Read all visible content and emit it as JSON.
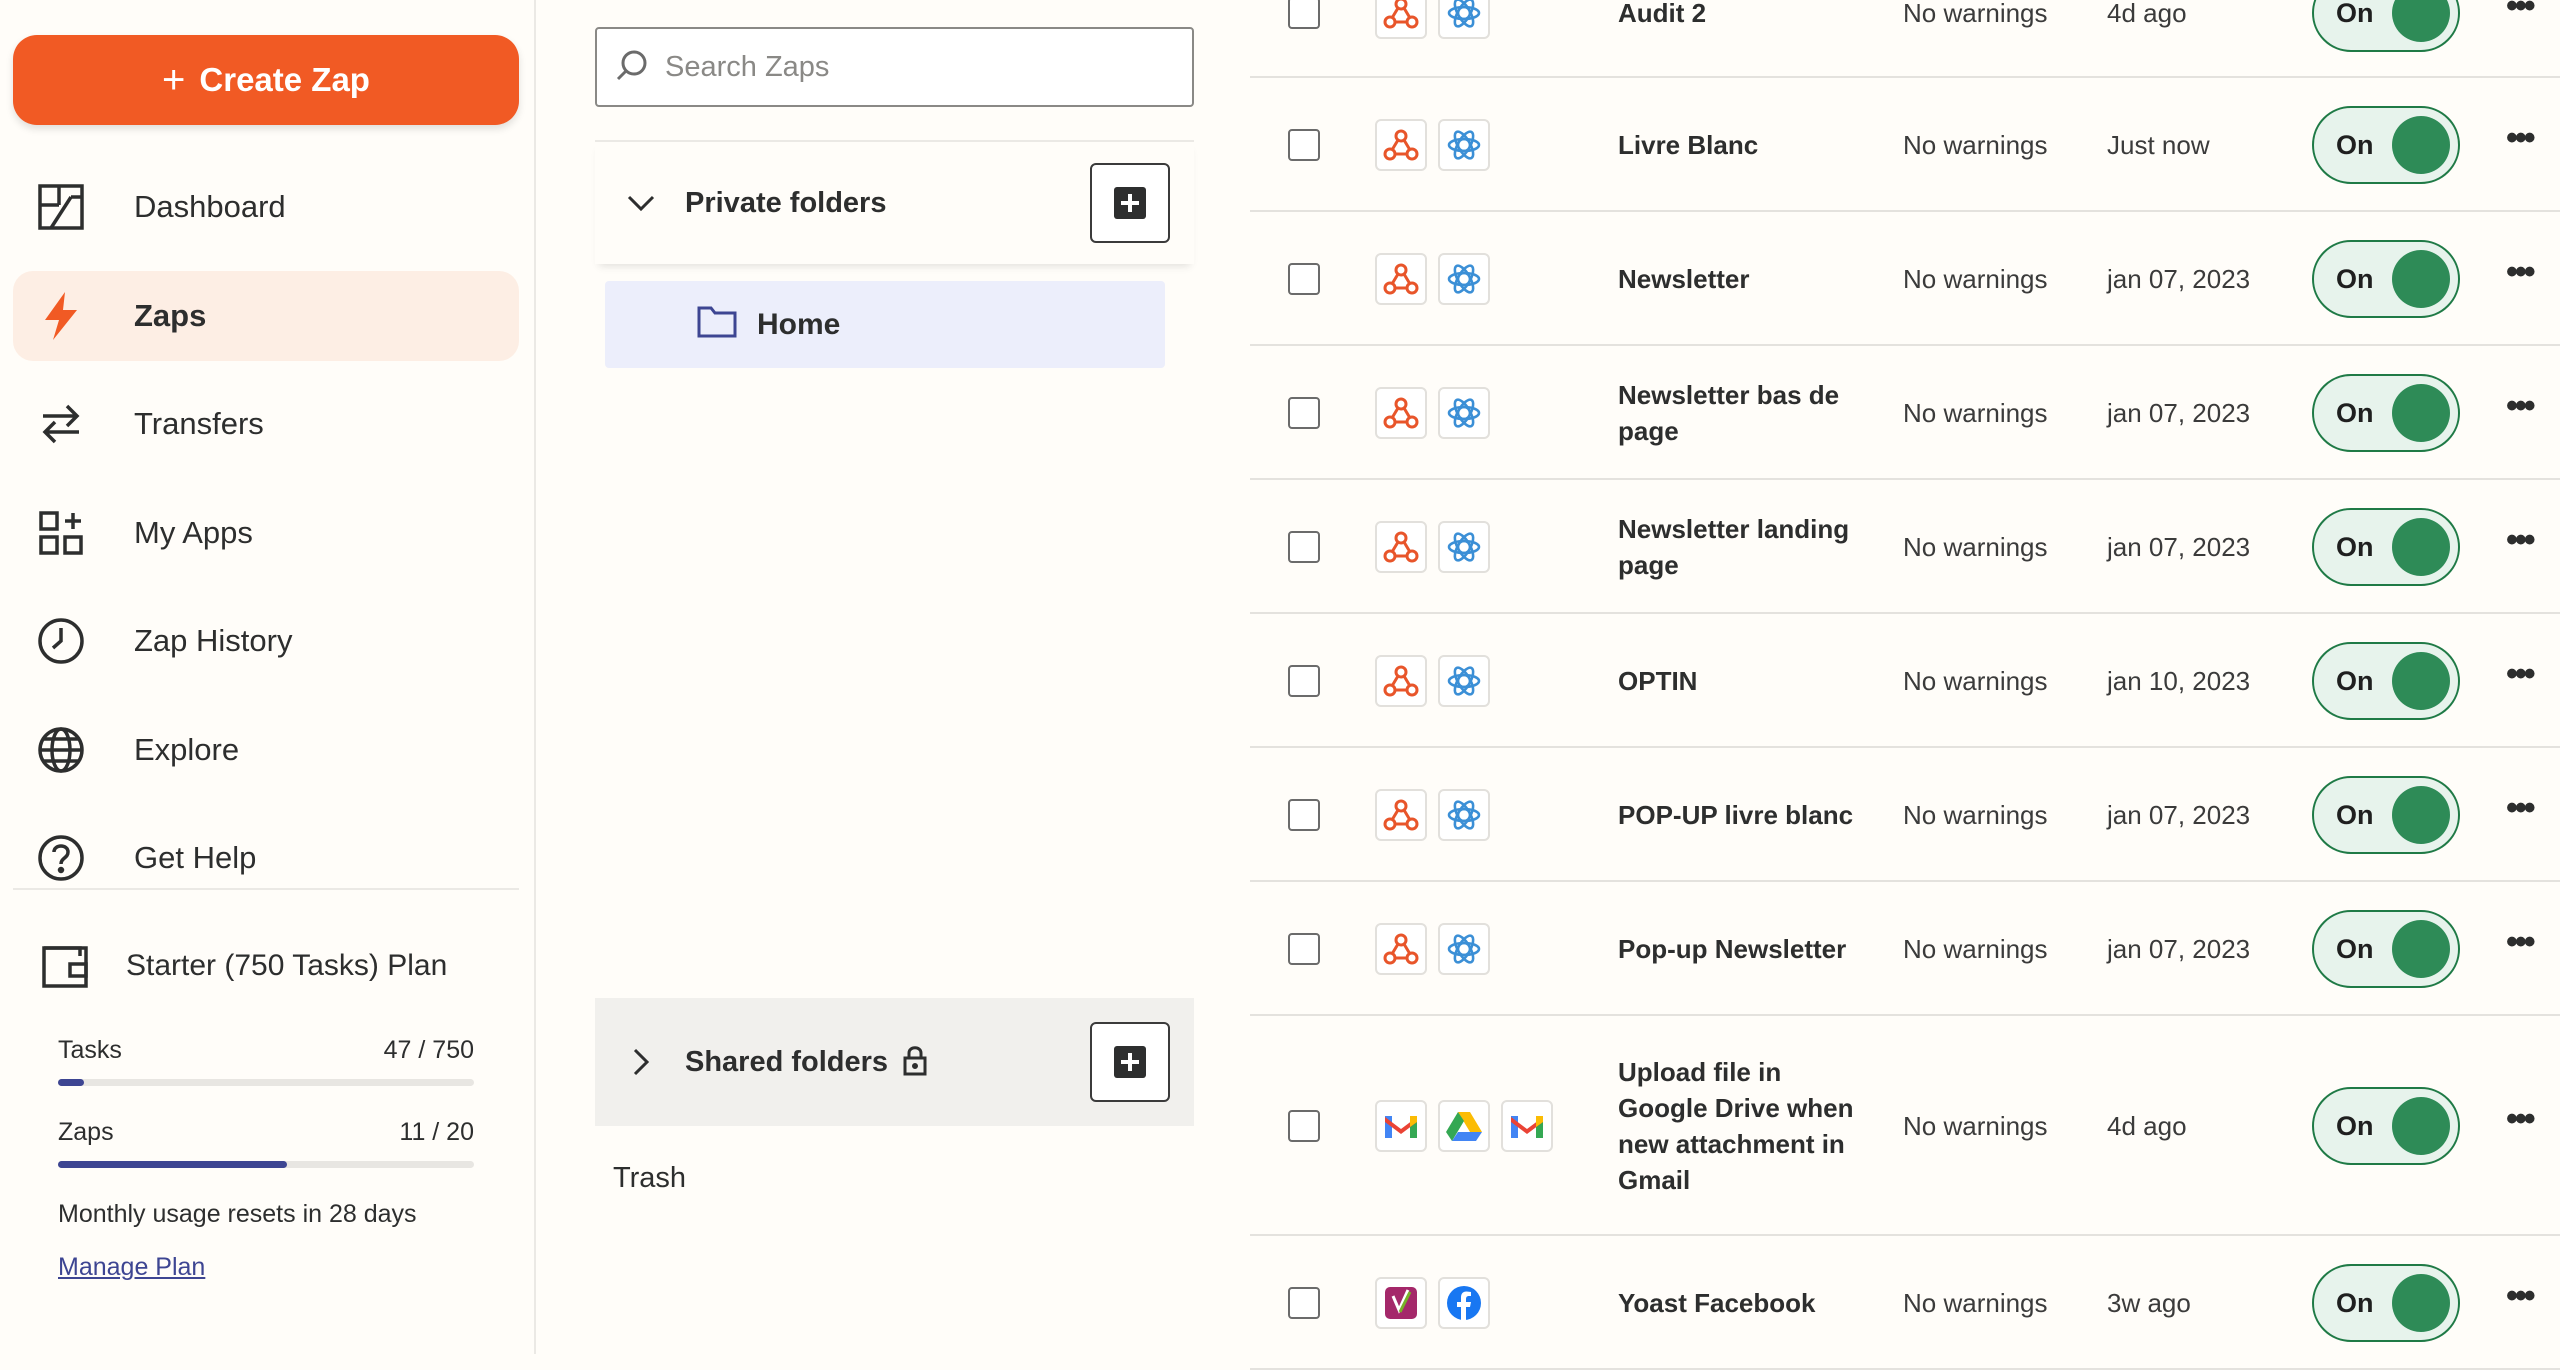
{
  "sidebar": {
    "create_label": "Create Zap",
    "nav": [
      {
        "label": "Dashboard",
        "icon": "dashboard-icon",
        "active": false
      },
      {
        "label": "Zaps",
        "icon": "lightning-icon",
        "active": true
      },
      {
        "label": "Transfers",
        "icon": "transfer-arrows-icon",
        "active": false
      },
      {
        "label": "My Apps",
        "icon": "apps-grid-icon",
        "active": false
      },
      {
        "label": "Zap History",
        "icon": "clock-icon",
        "active": false
      },
      {
        "label": "Explore",
        "icon": "globe-icon",
        "active": false
      },
      {
        "label": "Get Help",
        "icon": "help-circle-icon",
        "active": false
      }
    ],
    "plan": {
      "name": "Starter (750 Tasks) Plan",
      "tasks_label": "Tasks",
      "tasks_value": "47 / 750",
      "tasks_fraction": 0.063,
      "zaps_label": "Zaps",
      "zaps_value": "11 / 20",
      "zaps_fraction": 0.55,
      "reset_text": "Monthly usage resets in 28 days",
      "manage_label": "Manage Plan"
    }
  },
  "folders": {
    "search_placeholder": "Search Zaps",
    "private_label": "Private folders",
    "home_label": "Home",
    "shared_label": "Shared folders",
    "trash_label": "Trash"
  },
  "zaps": [
    {
      "name": "Audit 2",
      "warnings": "No warnings",
      "date": "4d ago",
      "status": "On",
      "apps": [
        "webhook-icon",
        "openai-icon"
      ]
    },
    {
      "name": "Livre Blanc",
      "warnings": "No warnings",
      "date": "Just now",
      "status": "On",
      "apps": [
        "webhook-icon",
        "openai-icon"
      ]
    },
    {
      "name": "Newsletter",
      "warnings": "No warnings",
      "date": "jan 07, 2023",
      "status": "On",
      "apps": [
        "webhook-icon",
        "openai-icon"
      ]
    },
    {
      "name": "Newsletter bas de page",
      "warnings": "No warnings",
      "date": "jan 07, 2023",
      "status": "On",
      "apps": [
        "webhook-icon",
        "openai-icon"
      ]
    },
    {
      "name": "Newsletter landing page",
      "warnings": "No warnings",
      "date": "jan 07, 2023",
      "status": "On",
      "apps": [
        "webhook-icon",
        "openai-icon"
      ]
    },
    {
      "name": "OPTIN",
      "warnings": "No warnings",
      "date": "jan 10, 2023",
      "status": "On",
      "apps": [
        "webhook-icon",
        "openai-icon"
      ]
    },
    {
      "name": "POP-UP livre blanc",
      "warnings": "No warnings",
      "date": "jan 07, 2023",
      "status": "On",
      "apps": [
        "webhook-icon",
        "openai-icon"
      ]
    },
    {
      "name": "Pop-up Newsletter",
      "warnings": "No warnings",
      "date": "jan 07, 2023",
      "status": "On",
      "apps": [
        "webhook-icon",
        "openai-icon"
      ]
    },
    {
      "name": "Upload file in Google Drive when new attachment in Gmail",
      "warnings": "No warnings",
      "date": "4d ago",
      "status": "On",
      "apps": [
        "gmail-icon",
        "google-drive-icon",
        "gmail-icon"
      ]
    },
    {
      "name": "Yoast Facebook",
      "warnings": "No warnings",
      "date": "3w ago",
      "status": "On",
      "apps": [
        "yoast-icon",
        "facebook-icon"
      ]
    }
  ],
  "colors": {
    "brand": "#f15a24",
    "on_green": "#2e8b57",
    "plan_bar": "#3d4592"
  }
}
